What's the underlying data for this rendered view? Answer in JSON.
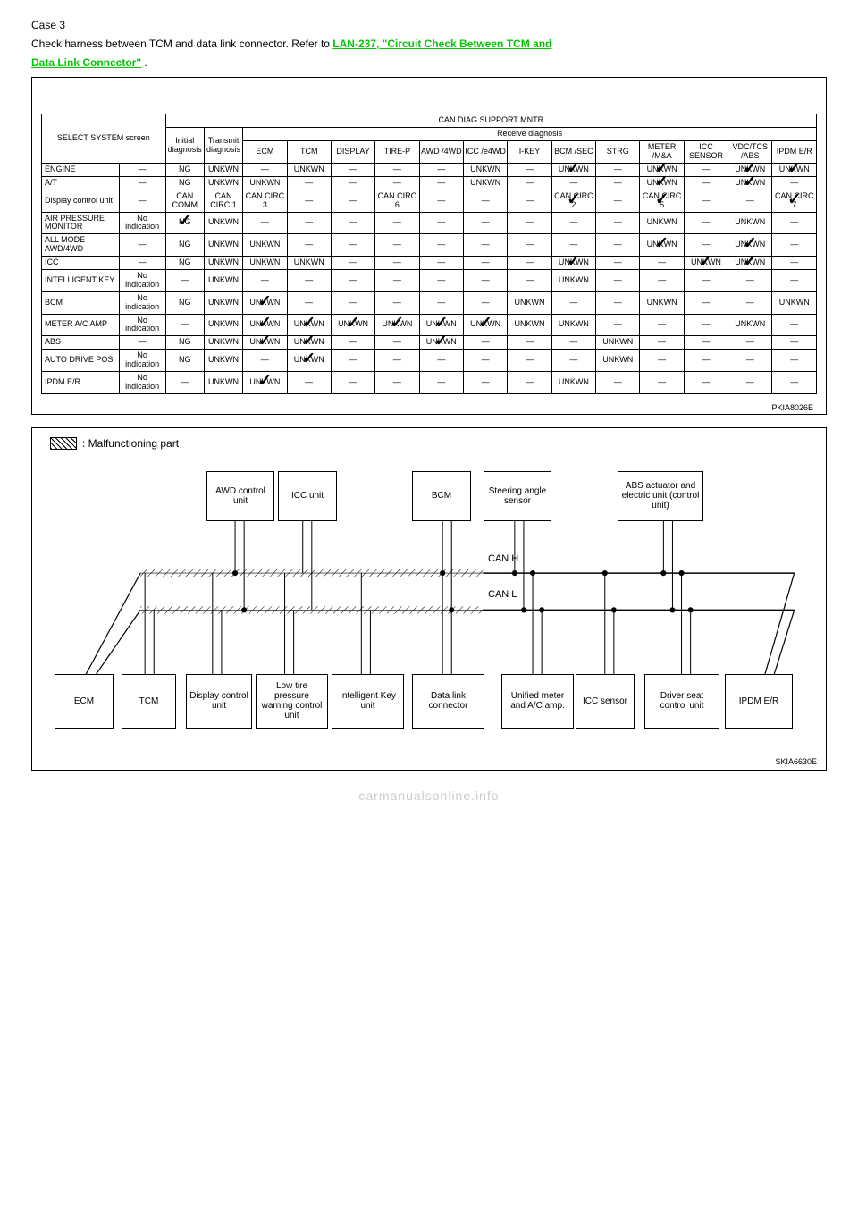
{
  "caseHeading": "Case 3",
  "caseText1": "Check harness between TCM and data link connector. Refer to ",
  "link1": "LAN-237, \"Circuit Check Between TCM and",
  "link2": "Data Link Connector\"",
  "period": " .",
  "table": {
    "mainHeader": "CAN DIAG SUPPORT MNTR",
    "selectSystem": "SELECT SYSTEM screen",
    "initial": "Initial diagnosis",
    "transmit": "Transmit diagnosis",
    "receive": "Receive diagnosis",
    "cols": [
      "ECM",
      "TCM",
      "DISPLAY",
      "TIRE-P",
      "AWD /4WD",
      "ICC /e4WD",
      "I-KEY",
      "BCM /SEC",
      "STRG",
      "METER /M&A",
      "ICC SENSOR",
      "VDC/TCS /ABS",
      "IPDM E/R"
    ],
    "rows": [
      {
        "label": "ENGINE",
        "sub": "—",
        "init": "NG",
        "trans": "UNKWN",
        "cells": [
          "—",
          "UNKWN",
          "—",
          "—",
          "—",
          "UNKWN",
          "—",
          "UNKWN✓",
          "—",
          "UNKWN✓",
          "—",
          "UNKWN✓",
          "UNKWN✓"
        ]
      },
      {
        "label": "A/T",
        "sub": "—",
        "init": "NG",
        "trans": "UNKWN",
        "cells": [
          "UNKWN",
          "—",
          "—",
          "—",
          "—",
          "UNKWN",
          "—",
          "—",
          "—",
          "UNKWN✓",
          "—",
          "UNKWN✓",
          "—"
        ]
      },
      {
        "label": "Display control unit",
        "sub": "—",
        "init": "CAN COMM",
        "trans": "CAN CIRC 1",
        "cells": [
          "CAN CIRC 3",
          "—",
          "—",
          "CAN CIRC 6",
          "—",
          "—",
          "—",
          "CAN CIRC 2✓",
          "—",
          "CAN CIRC 5✓",
          "—",
          "—",
          "CAN CIRC 7✓"
        ]
      },
      {
        "label": "AIR PRESSURE MONITOR",
        "sub": "No indication",
        "init": "NG✓",
        "trans": "UNKWN",
        "cells": [
          "—",
          "—",
          "—",
          "—",
          "—",
          "—",
          "—",
          "—",
          "—",
          "UNKWN",
          "—",
          "UNKWN",
          "—"
        ]
      },
      {
        "label": "ALL MODE AWD/4WD",
        "sub": "—",
        "init": "NG",
        "trans": "UNKWN",
        "cells": [
          "UNKWN",
          "—",
          "—",
          "—",
          "—",
          "—",
          "—",
          "—",
          "—",
          "UNKWN✓",
          "—",
          "UNKWN✓",
          "—"
        ]
      },
      {
        "label": "ICC",
        "sub": "—",
        "init": "NG",
        "trans": "UNKWN",
        "cells": [
          "UNKWN",
          "UNKWN",
          "—",
          "—",
          "—",
          "—",
          "—",
          "UNKWN✓",
          "—",
          "—",
          "UNKWN✓",
          "UNKWN✓",
          "—"
        ]
      },
      {
        "label": "INTELLIGENT KEY",
        "sub": "No indication",
        "init": "—",
        "trans": "UNKWN",
        "cells": [
          "—",
          "—",
          "—",
          "—",
          "—",
          "—",
          "—",
          "UNKWN",
          "—",
          "—",
          "—",
          "—",
          "—"
        ]
      },
      {
        "label": "BCM",
        "sub": "No indication",
        "init": "NG",
        "trans": "UNKWN",
        "cells": [
          "UNKWN✓",
          "—",
          "—",
          "—",
          "—",
          "—",
          "UNKWN",
          "—",
          "—",
          "UNKWN",
          "—",
          "—",
          "UNKWN"
        ]
      },
      {
        "label": "METER A/C AMP",
        "sub": "No indication",
        "init": "—",
        "trans": "UNKWN",
        "cells": [
          "UNKWN✓",
          "UNKWN✓",
          "UNKWN✓",
          "UNKWN✓",
          "UNKWN✓",
          "UNKWN✓",
          "UNKWN",
          "UNKWN",
          "—",
          "—",
          "—",
          "UNKWN",
          "—"
        ]
      },
      {
        "label": "ABS",
        "sub": "—",
        "init": "NG",
        "trans": "UNKWN",
        "cells": [
          "UNKWN✓",
          "UNKWN✓",
          "—",
          "—",
          "UNKWN✓",
          "—",
          "—",
          "—",
          "UNKWN",
          "—",
          "—",
          "—",
          "—"
        ]
      },
      {
        "label": "AUTO DRIVE POS.",
        "sub": "No indication",
        "init": "NG",
        "trans": "UNKWN",
        "cells": [
          "—",
          "UNKWN✓",
          "—",
          "—",
          "—",
          "—",
          "—",
          "—",
          "UNKWN",
          "—",
          "—",
          "—",
          "—"
        ]
      },
      {
        "label": "IPDM E/R",
        "sub": "No indication",
        "init": "—",
        "trans": "UNKWN",
        "cells": [
          "UNKWN✓",
          "—",
          "—",
          "—",
          "—",
          "—",
          "—",
          "UNKWN",
          "—",
          "—",
          "—",
          "—",
          "—"
        ]
      }
    ],
    "partno": "PKIA8026E"
  },
  "diagram": {
    "legend": ": Malfunctioning part",
    "canH": "CAN H",
    "canL": "CAN L",
    "partno": "SKIA6630E",
    "topBlocks": [
      "AWD control unit",
      "ICC unit",
      "BCM",
      "Steering angle sensor",
      "ABS actuator and electric unit (control unit)"
    ],
    "bottomBlocks": [
      "ECM",
      "TCM",
      "Display control unit",
      "Low tire pressure warning control unit",
      "Intelligent Key unit",
      "Data link connector",
      "Unified meter and A/C amp.",
      "ICC sensor",
      "Driver seat control unit",
      "IPDM E/R"
    ]
  },
  "watermark": "carmanualsonline.info"
}
